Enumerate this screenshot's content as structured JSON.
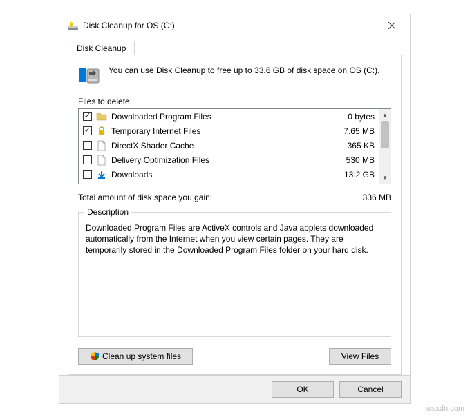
{
  "window": {
    "title": "Disk Cleanup for OS (C:)"
  },
  "tab": {
    "label": "Disk Cleanup"
  },
  "info": {
    "text": "You can use Disk Cleanup to free up to 33.6 GB of disk space on OS (C:)."
  },
  "filesLabel": "Files to delete:",
  "files": [
    {
      "checked": true,
      "icon": "folder",
      "name": "Downloaded Program Files",
      "size": "0 bytes"
    },
    {
      "checked": true,
      "icon": "lock",
      "name": "Temporary Internet Files",
      "size": "7.65 MB"
    },
    {
      "checked": false,
      "icon": "file",
      "name": "DirectX Shader Cache",
      "size": "365 KB"
    },
    {
      "checked": false,
      "icon": "file",
      "name": "Delivery Optimization Files",
      "size": "530 MB"
    },
    {
      "checked": false,
      "icon": "download",
      "name": "Downloads",
      "size": "13.2 GB"
    }
  ],
  "total": {
    "label": "Total amount of disk space you gain:",
    "value": "336 MB"
  },
  "description": {
    "title": "Description",
    "text": "Downloaded Program Files are ActiveX controls and Java applets downloaded automatically from the Internet when you view certain pages. They are temporarily stored in the Downloaded Program Files folder on your hard disk."
  },
  "buttons": {
    "cleanSystem": "Clean up system files",
    "viewFiles": "View Files",
    "ok": "OK",
    "cancel": "Cancel"
  },
  "watermark": "wsxdn.com"
}
